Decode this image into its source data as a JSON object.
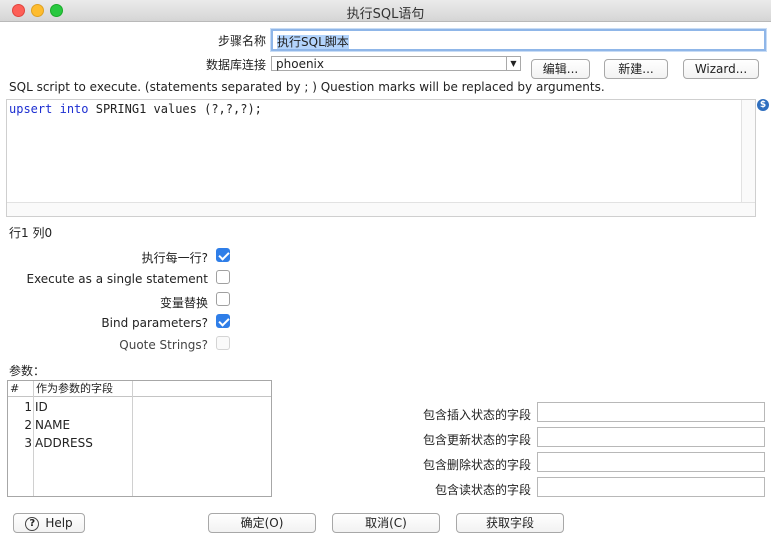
{
  "window": {
    "title": "执行SQL语句"
  },
  "form": {
    "step_name_label": "步骤名称",
    "step_name_value": "执行SQL脚本",
    "connection_label": "数据库连接",
    "connection_value": "phoenix",
    "edit_button": "编辑...",
    "new_button": "新建...",
    "wizard_button": "Wizard...",
    "sql_hint": "SQL script to execute. (statements separated by ; ) Question marks will be replaced by arguments.",
    "sql_kw1": "upsert",
    "sql_kw2": "into",
    "sql_rest": " SPRING1 values (?,?,?);",
    "cursor_pos": "行1 列0",
    "variable_icon": "$"
  },
  "options": {
    "exec_each_row_label": "执行每一行?",
    "exec_each_row_checked": true,
    "single_statement_label": "Execute as a single statement",
    "single_statement_checked": false,
    "var_substitution_label": "变量替换",
    "var_substitution_checked": false,
    "bind_params_label": "Bind parameters?",
    "bind_params_checked": true,
    "quote_strings_label": "Quote Strings?",
    "quote_strings_checked": false
  },
  "params": {
    "section_label": "参数：",
    "col_num": "#",
    "col_field": "作为参数的字段",
    "rows": [
      {
        "num": "1",
        "field": "ID"
      },
      {
        "num": "2",
        "field": "NAME"
      },
      {
        "num": "3",
        "field": "ADDRESS"
      }
    ]
  },
  "status_fields": {
    "insert_label": "包含插入状态的字段",
    "update_label": "包含更新状态的字段",
    "delete_label": "包含删除状态的字段",
    "read_label": "包含读状态的字段"
  },
  "buttons": {
    "help": "Help",
    "ok": "确定(O)",
    "cancel": "取消(C)",
    "get_fields": "获取字段"
  },
  "colors": {
    "accent": "#2f7ee8",
    "keyword": "#1d2fd1"
  }
}
